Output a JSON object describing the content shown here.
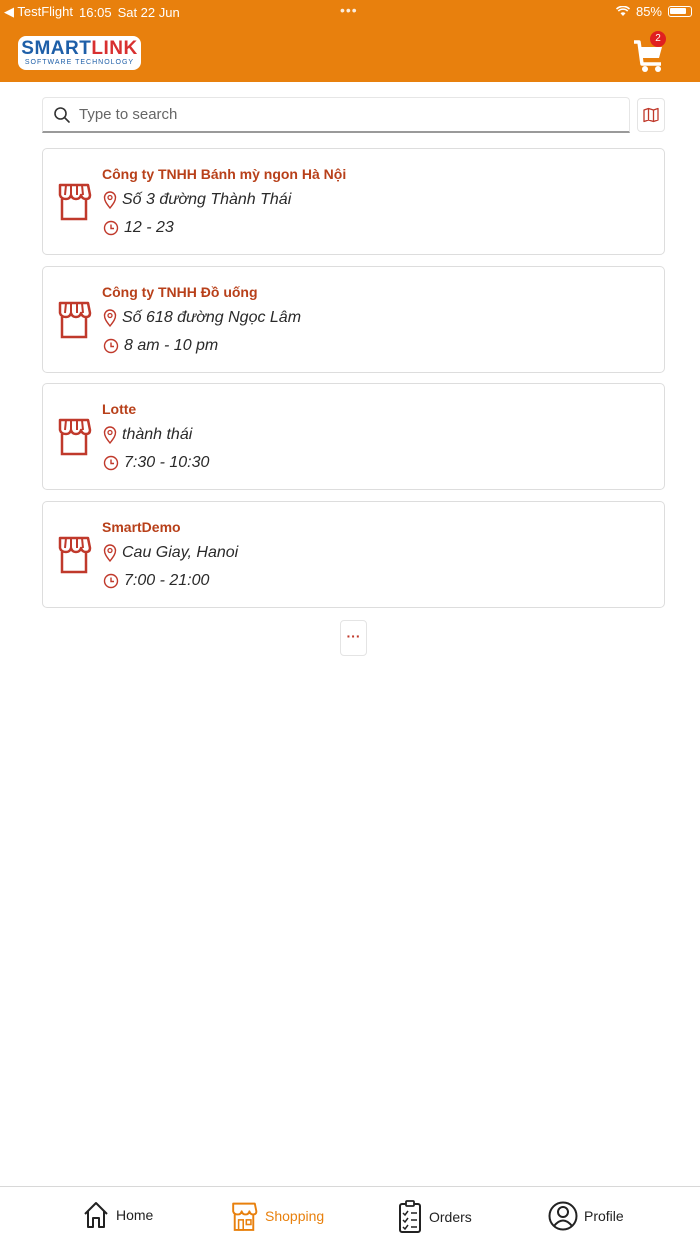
{
  "status": {
    "back_app": "TestFlight",
    "time": "16:05",
    "date": "Sat 22 Jun",
    "dots": "•••",
    "battery": "85%"
  },
  "header": {
    "logo_main_a": "SMART",
    "logo_main_b": "LINK",
    "logo_sub": "SOFTWARE TECHNOLOGY",
    "cart_count": "2"
  },
  "search": {
    "placeholder": "Type to search",
    "value": ""
  },
  "stores": [
    {
      "name": "Công ty TNHH Bánh mỳ ngon Hà Nội",
      "address": "Số 3 đường Thành Thái",
      "hours": "12 - 23"
    },
    {
      "name": "Công ty TNHH Đồ uống",
      "address": "Số 618 đường Ngọc Lâm",
      "hours": "8 am - 10 pm"
    },
    {
      "name": "Lotte",
      "address": "thành thái",
      "hours": "7:30 - 10:30"
    },
    {
      "name": "SmartDemo",
      "address": "Cau Giay, Hanoi",
      "hours": "7:00 - 21:00"
    }
  ],
  "load_more_label": "···",
  "nav": {
    "home": "Home",
    "shopping": "Shopping",
    "orders": "Orders",
    "profile": "Profile",
    "active": "shopping"
  },
  "colors": {
    "brand_orange": "#e8800d",
    "store_red": "#b8401a",
    "badge_red": "#e02020"
  }
}
